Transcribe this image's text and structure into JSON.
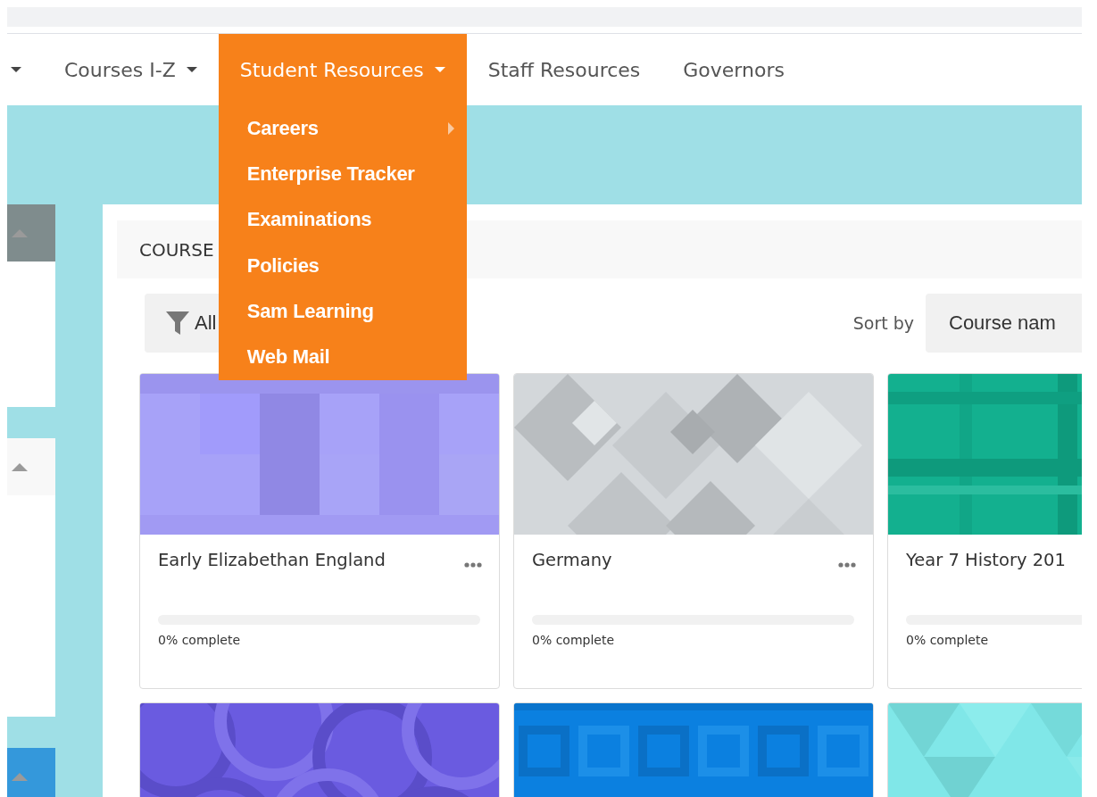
{
  "nav": {
    "items": [
      {
        "caret": true,
        "selected": false
      },
      {
        "label": "Courses I-Z",
        "caret": true,
        "selected": false
      },
      {
        "label": "Student Resources",
        "caret": true,
        "selected": true,
        "menu": [
          {
            "label": "Careers",
            "submenu": true
          },
          {
            "label": "Enterprise Tracker",
            "submenu": false
          },
          {
            "label": "Examinations",
            "submenu": false
          },
          {
            "label": "Policies",
            "submenu": false
          },
          {
            "label": "Sam Learning",
            "submenu": false
          },
          {
            "label": "Web Mail",
            "submenu": false
          }
        ]
      },
      {
        "label": "Staff Resources",
        "caret": false,
        "selected": false
      },
      {
        "label": "Governors",
        "caret": false,
        "selected": false
      }
    ]
  },
  "sidebar": {
    "blocks": [
      {
        "color": "#7f8c8d"
      },
      {
        "color": "#f8f8f8"
      },
      {
        "color": "#3498db"
      }
    ]
  },
  "course_overview": {
    "title": "COURSE",
    "filter": {
      "label": "All"
    },
    "sort": {
      "label": "Sort by",
      "value": "Course nam"
    },
    "cards": [
      {
        "kind": "picture",
        "title": "Early Elizabethan England",
        "more_button": true,
        "level": 0,
        "progress": "0% complete"
      },
      {
        "kind": "picture",
        "title": "Germany",
        "more_button": true,
        "level": 0,
        "progress": "0% complete"
      },
      {
        "kind": "picture",
        "title": "Year 7 History 201",
        "more_button": false,
        "level": 0,
        "progress": "0% complete"
      },
      {
        "kind": "picture"
      },
      {
        "kind": "picture"
      },
      {
        "kind": "picture"
      }
    ]
  }
}
